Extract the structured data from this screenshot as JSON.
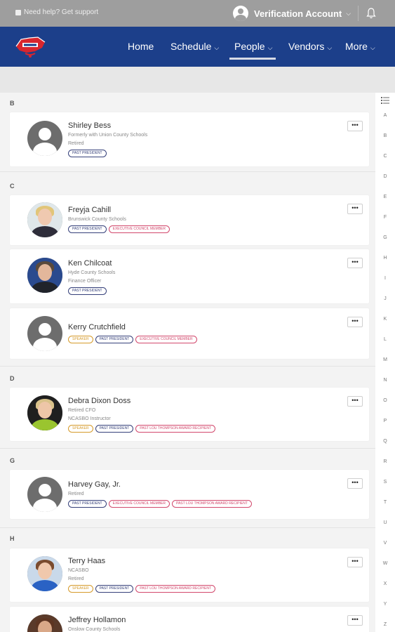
{
  "topbar": {
    "help_text": "Need help? Get support",
    "account_name": "Verification Account"
  },
  "nav": {
    "items": [
      {
        "label": "Home",
        "dropdown": false
      },
      {
        "label": "Schedule",
        "dropdown": true
      },
      {
        "label": "People",
        "dropdown": true,
        "active": true
      },
      {
        "label": "Vendors",
        "dropdown": true
      },
      {
        "label": "More",
        "dropdown": true
      }
    ]
  },
  "sections": [
    {
      "letter": "B"
    },
    {
      "letter": "C"
    },
    {
      "letter": "D"
    },
    {
      "letter": "G"
    },
    {
      "letter": "H"
    }
  ],
  "people": [
    {
      "name": "Shirley Bess",
      "lines": [
        "Formerly with Union County Schools",
        "Retired"
      ],
      "tags": [
        "PAST PRESIDENT"
      ]
    },
    {
      "name": "Freyja Cahill",
      "lines": [
        "Brunswick County Schools"
      ],
      "tags": [
        "PAST PRESIDENT",
        "EXECUTIVE COUNCIL MEMBER"
      ]
    },
    {
      "name": "Ken Chilcoat",
      "lines": [
        "Hyde County Schools",
        "Finance Officer"
      ],
      "tags": [
        "PAST PRESIDENT"
      ]
    },
    {
      "name": "Kerry Crutchfield",
      "lines": [],
      "tags": [
        "SPEAKER",
        "PAST PRESIDENT",
        "EXECUTIVE COUNCIL MEMBER"
      ]
    },
    {
      "name": "Debra Dixon Doss",
      "lines": [
        "Retired CFO",
        "NCASBO Instructor"
      ],
      "tags": [
        "SPEAKER",
        "PAST PRESIDENT",
        "PAST LOU THOMPSON AWARD RECIPIENT"
      ]
    },
    {
      "name": "Harvey Gay, Jr.",
      "lines": [
        "Retired"
      ],
      "tags": [
        "PAST PRESIDENT",
        "EXECUTIVE COUNCIL MEMBER",
        "PAST LOU THOMPSON AWARD RECIPIENT"
      ]
    },
    {
      "name": "Terry Haas",
      "lines": [
        "NCASBO",
        "Retired"
      ],
      "tags": [
        "SPEAKER",
        "PAST PRESIDENT",
        "PAST LOU THOMPSON AWARD RECIPIENT"
      ]
    },
    {
      "name": "Jeffrey Hollamon",
      "lines": [
        "Onslow County Schools"
      ],
      "tags": []
    }
  ],
  "more_button_label": "•••",
  "alphabet": [
    "A",
    "B",
    "C",
    "D",
    "E",
    "F",
    "G",
    "H",
    "I",
    "J",
    "K",
    "L",
    "M",
    "N",
    "O",
    "P",
    "Q",
    "R",
    "S",
    "T",
    "U",
    "V",
    "W",
    "X",
    "Y",
    "Z"
  ],
  "colors": {
    "topbar": "#9e9e9e",
    "navbar": "#1c3f8a",
    "past_president_tag": "#35407a",
    "council_tag": "#d2486c",
    "speaker_tag": "#d59a2a"
  }
}
